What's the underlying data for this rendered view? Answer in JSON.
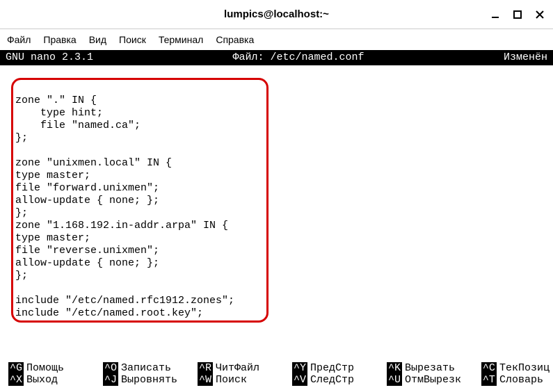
{
  "titlebar": {
    "title": "lumpics@localhost:~"
  },
  "menu": {
    "file": "Файл",
    "edit": "Правка",
    "view": "Вид",
    "search": "Поиск",
    "terminal": "Терминал",
    "help": "Справка"
  },
  "nano": {
    "version": "GNU nano 2.3.1",
    "file_label": "Файл: /etc/named.conf",
    "status": "Изменён"
  },
  "editor_lines": [
    "",
    "",
    "zone \".\" IN {",
    "    type hint;",
    "    file \"named.ca\";",
    "};",
    "",
    "zone \"unixmen.local\" IN {",
    "type master;",
    "file \"forward.unixmen\";",
    "allow-update { none; };",
    "};",
    "zone \"1.168.192.in-addr.arpa\" IN {",
    "type master;",
    "file \"reverse.unixmen\";",
    "allow-update { none; };",
    "};",
    "",
    "include \"/etc/named.rfc1912.zones\";",
    "include \"/etc/named.root.key\";"
  ],
  "shortcuts": {
    "row1": [
      {
        "key": "^G",
        "label": "Помощь"
      },
      {
        "key": "^O",
        "label": "Записать"
      },
      {
        "key": "^R",
        "label": "ЧитФайл"
      },
      {
        "key": "^Y",
        "label": "ПредСтр"
      },
      {
        "key": "^K",
        "label": "Вырезать"
      },
      {
        "key": "^C",
        "label": "ТекПозиц"
      }
    ],
    "row2": [
      {
        "key": "^X",
        "label": "Выход"
      },
      {
        "key": "^J",
        "label": "Выровнять"
      },
      {
        "key": "^W",
        "label": "Поиск"
      },
      {
        "key": "^V",
        "label": "СледСтр"
      },
      {
        "key": "^U",
        "label": "ОтмВырезк"
      },
      {
        "key": "^T",
        "label": "Словарь"
      }
    ]
  }
}
